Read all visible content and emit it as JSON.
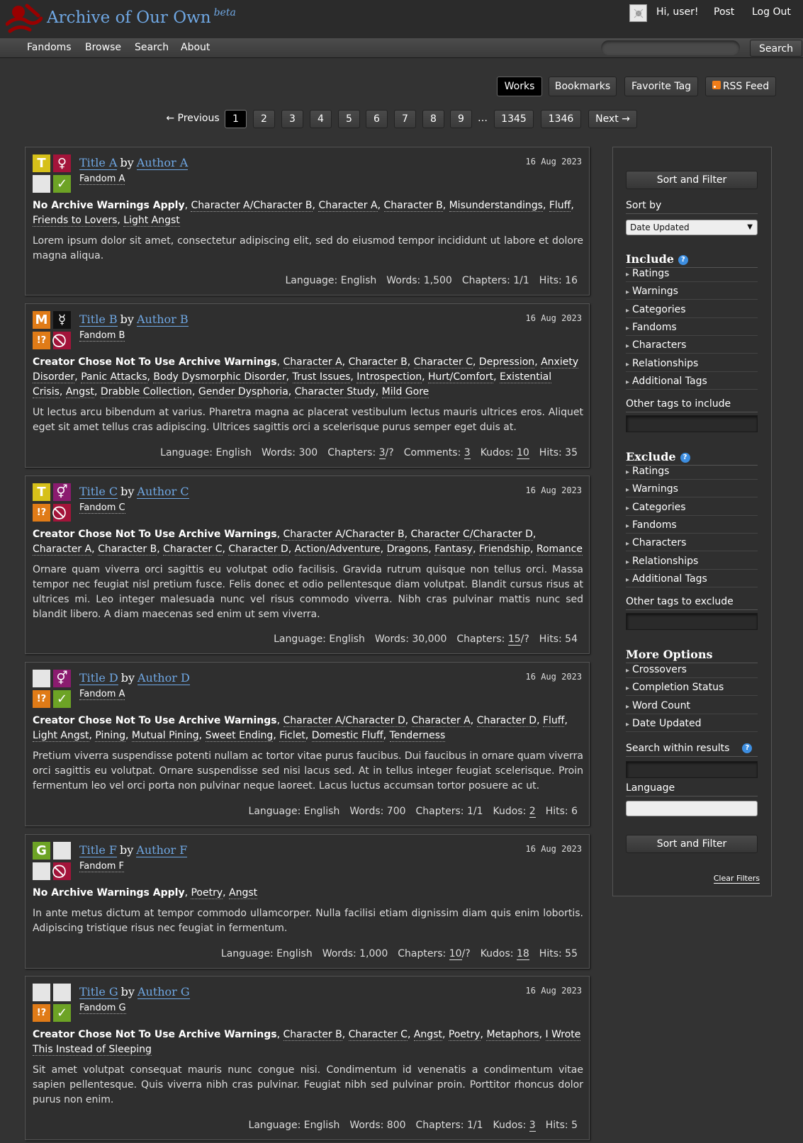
{
  "header": {
    "site_title": "Archive of Our Own",
    "beta": "beta",
    "greeting": "Hi, user!",
    "post": "Post",
    "logout": "Log Out"
  },
  "nav": {
    "items": [
      "Fandoms",
      "Browse",
      "Search",
      "About"
    ],
    "search_button": "Search"
  },
  "tabs": {
    "works": "Works",
    "bookmarks": "Bookmarks",
    "favorite": "Favorite Tag",
    "rss": "RSS Feed"
  },
  "pagination": {
    "previous": "← Previous",
    "pages": [
      "1",
      "2",
      "3",
      "4",
      "5",
      "6",
      "7",
      "8",
      "9"
    ],
    "gap": "…",
    "last_pages": [
      "1345",
      "1346"
    ],
    "next": "Next →",
    "current": "1"
  },
  "works": [
    {
      "title": "Title A",
      "by": "by",
      "author": "Author A",
      "fandom": "Fandom A",
      "date": "16 Aug 2023",
      "icons": [
        {
          "name": "rating-teen-icon",
          "glyph": "T",
          "color": "#d6c01a"
        },
        {
          "name": "category-ff-icon",
          "glyph": "♀",
          "color": "#a3143a"
        },
        {
          "name": "warning-none-icon",
          "glyph": "",
          "color": "#e5e5e5"
        },
        {
          "name": "complete-icon",
          "glyph": "✓",
          "color": "#6da325"
        }
      ],
      "warning": "No Archive Warnings Apply",
      "tags": [
        "Character A/Character B",
        "Character A",
        "Character B",
        "Misunderstandings",
        "Fluff",
        "Friends to Lovers",
        "Light Angst"
      ],
      "summary": "Lorem ipsum dolor sit amet, consectetur adipiscing elit, sed do eiusmod tempor incididunt ut labore et dolore magna aliqua.",
      "stats": {
        "language_label": "Language:",
        "language": "English",
        "words_label": "Words:",
        "words": "1,500",
        "chapters_label": "Chapters:",
        "chapters": "1/1",
        "hits_label": "Hits:",
        "hits": "16"
      }
    },
    {
      "title": "Title B",
      "by": "by",
      "author": "Author B",
      "fandom": "Fandom B",
      "date": "16 Aug 2023",
      "icons": [
        {
          "name": "rating-mature-icon",
          "glyph": "M",
          "color": "#e07b17"
        },
        {
          "name": "category-other-icon",
          "glyph": "☿",
          "color": "#111111"
        },
        {
          "name": "warning-choose-not-icon",
          "glyph": "!?",
          "color": "#e07b17"
        },
        {
          "name": "incomplete-icon",
          "glyph": "⃠",
          "color": "#a3143a"
        }
      ],
      "warning": "Creator Chose Not To Use Archive Warnings",
      "tags": [
        "Character A",
        "Character B",
        "Character C",
        "Depression",
        "Anxiety Disorder",
        "Panic Attacks",
        "Body Dysmorphic Disorder",
        "Trust Issues",
        "Introspection",
        "Hurt/Comfort",
        "Existential Crisis",
        "Angst",
        "Drabble Collection",
        "Gender Dysphoria",
        "Character Study",
        "Mild Gore"
      ],
      "summary": "Ut lectus arcu bibendum at varius. Pharetra magna ac placerat vestibulum lectus mauris ultrices eros. Aliquet eget sit amet tellus cras adipiscing. Ultrices sagittis orci a scelerisque purus semper eget duis at.",
      "stats": {
        "language_label": "Language:",
        "language": "English",
        "words_label": "Words:",
        "words": "300",
        "chapters_label": "Chapters:",
        "chapters_done": "3",
        "chapters_total": "/?",
        "comments_label": "Comments:",
        "comments": "3",
        "kudos_label": "Kudos:",
        "kudos": "10",
        "hits_label": "Hits:",
        "hits": "35"
      }
    },
    {
      "title": "Title C",
      "by": "by",
      "author": "Author C",
      "fandom": "Fandom C",
      "date": "16 Aug 2023",
      "icons": [
        {
          "name": "rating-teen-icon",
          "glyph": "T",
          "color": "#d6c01a"
        },
        {
          "name": "category-multi-icon",
          "glyph": "⚥",
          "color": "#8b1c6f"
        },
        {
          "name": "warning-choose-not-icon",
          "glyph": "!?",
          "color": "#e07b17"
        },
        {
          "name": "incomplete-icon",
          "glyph": "⃠",
          "color": "#a3143a"
        }
      ],
      "warning": "Creator Chose Not To Use Archive Warnings",
      "tags": [
        "Character A/Character B",
        "Character C/Character D",
        "Character A",
        "Character B",
        "Character C",
        "Character D",
        "Action/Adventure",
        "Dragons",
        "Fantasy",
        "Friendship",
        "Romance"
      ],
      "summary": "Ornare quam viverra orci sagittis eu volutpat odio facilisis. Gravida rutrum quisque non tellus orci. Massa tempor nec feugiat nisl pretium fusce. Felis donec et odio pellentesque diam volutpat. Blandit cursus risus at ultrices mi. Leo integer malesuada nunc vel risus commodo viverra. Nibh cras pulvinar mattis nunc sed blandit libero. A diam maecenas sed enim ut sem viverra.",
      "stats": {
        "language_label": "Language:",
        "language": "English",
        "words_label": "Words:",
        "words": "30,000",
        "chapters_label": "Chapters:",
        "chapters_done": "15",
        "chapters_total": "/?",
        "hits_label": "Hits:",
        "hits": "54"
      }
    },
    {
      "title": "Title D",
      "by": "by",
      "author": "Author D",
      "fandom": "Fandom A",
      "date": "16 Aug 2023",
      "icons": [
        {
          "name": "rating-none-icon",
          "glyph": "",
          "color": "#e5e5e5"
        },
        {
          "name": "category-multi-icon",
          "glyph": "⚥",
          "color": "#8b1c6f"
        },
        {
          "name": "warning-choose-not-icon",
          "glyph": "!?",
          "color": "#e07b17"
        },
        {
          "name": "complete-icon",
          "glyph": "✓",
          "color": "#6da325"
        }
      ],
      "warning": "Creator Chose Not To Use Archive Warnings",
      "tags": [
        "Character A/Character D",
        "Character A",
        "Character D",
        "Fluff",
        "Light Angst",
        "Pining",
        "Mutual Pining",
        "Sweet Ending",
        "Ficlet",
        "Domestic Fluff",
        "Tenderness"
      ],
      "summary": "Pretium viverra suspendisse potenti nullam ac tortor vitae purus faucibus. Dui faucibus in ornare quam viverra orci sagittis eu volutpat. Ornare suspendisse sed nisi lacus sed. At in tellus integer feugiat scelerisque. Proin fermentum leo vel orci porta non pulvinar neque laoreet. Lacus luctus accumsan tortor posuere ac ut.",
      "stats": {
        "language_label": "Language:",
        "language": "English",
        "words_label": "Words:",
        "words": "700",
        "chapters_label": "Chapters:",
        "chapters": "1/1",
        "kudos_label": "Kudos:",
        "kudos": "2",
        "hits_label": "Hits:",
        "hits": "6"
      }
    },
    {
      "title": "Title F",
      "by": "by",
      "author": "Author F",
      "fandom": "Fandom F",
      "date": "16 Aug 2023",
      "icons": [
        {
          "name": "rating-general-icon",
          "glyph": "G",
          "color": "#6da325"
        },
        {
          "name": "category-none-icon",
          "glyph": "",
          "color": "#e5e5e5"
        },
        {
          "name": "warning-none-icon",
          "glyph": "",
          "color": "#e5e5e5"
        },
        {
          "name": "incomplete-icon",
          "glyph": "⃠",
          "color": "#a3143a"
        }
      ],
      "warning": "No Archive Warnings Apply",
      "tags": [
        "Poetry",
        "Angst"
      ],
      "summary": "In ante metus dictum at tempor commodo ullamcorper. Nulla facilisi etiam dignissim diam quis enim lobortis. Adipiscing tristique risus nec feugiat in fermentum.",
      "stats": {
        "language_label": "Language:",
        "language": "English",
        "words_label": "Words:",
        "words": "1,000",
        "chapters_label": "Chapters:",
        "chapters_done": "10",
        "chapters_total": "/?",
        "kudos_label": "Kudos:",
        "kudos": "18",
        "hits_label": "Hits:",
        "hits": "55"
      }
    },
    {
      "title": "Title G",
      "by": "by",
      "author": "Author G",
      "fandom": "Fandom G",
      "date": "16 Aug 2023",
      "icons": [
        {
          "name": "rating-none-icon",
          "glyph": "",
          "color": "#e5e5e5"
        },
        {
          "name": "category-none-icon",
          "glyph": "",
          "color": "#e5e5e5"
        },
        {
          "name": "warning-choose-not-icon",
          "glyph": "!?",
          "color": "#e07b17"
        },
        {
          "name": "complete-icon",
          "glyph": "✓",
          "color": "#6da325"
        }
      ],
      "warning": "Creator Chose Not To Use Archive Warnings",
      "tags": [
        "Character B",
        "Character C",
        "Angst",
        "Poetry",
        "Metaphors",
        "I Wrote This Instead of Sleeping"
      ],
      "summary": "Sit amet volutpat consequat mauris nunc congue nisi. Condimentum id venenatis a condimentum vitae sapien pellentesque. Quis viverra nibh cras pulvinar. Feugiat nibh sed pulvinar proin. Porttitor rhoncus dolor purus non enim.",
      "stats": {
        "language_label": "Language:",
        "language": "English",
        "words_label": "Words:",
        "words": "800",
        "chapters_label": "Chapters:",
        "chapters": "1/1",
        "kudos_label": "Kudos:",
        "kudos": "3",
        "hits_label": "Hits:",
        "hits": "5"
      }
    }
  ],
  "sidebar": {
    "submit": "Sort and Filter",
    "sort_by": "Sort by",
    "sort_value": "Date Updated",
    "include": "Include",
    "include_items": [
      "Ratings",
      "Warnings",
      "Categories",
      "Fandoms",
      "Characters",
      "Relationships",
      "Additional Tags"
    ],
    "other_include": "Other tags to include",
    "exclude": "Exclude",
    "exclude_items": [
      "Ratings",
      "Warnings",
      "Categories",
      "Fandoms",
      "Characters",
      "Relationships",
      "Additional Tags"
    ],
    "other_exclude": "Other tags to exclude",
    "more": "More Options",
    "more_items": [
      "Crossovers",
      "Completion Status",
      "Word Count",
      "Date Updated"
    ],
    "search_within": "Search within results",
    "language": "Language",
    "clear": "Clear Filters",
    "help": "?"
  }
}
